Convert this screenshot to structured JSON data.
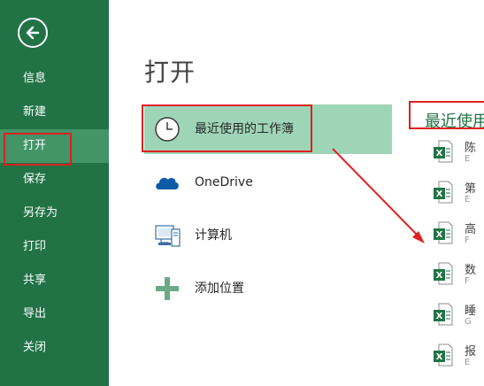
{
  "sidebar": {
    "items": [
      {
        "label": "信息"
      },
      {
        "label": "新建"
      },
      {
        "label": "打开"
      },
      {
        "label": "保存"
      },
      {
        "label": "另存为"
      },
      {
        "label": "打印"
      },
      {
        "label": "共享"
      },
      {
        "label": "导出"
      },
      {
        "label": "关闭"
      }
    ],
    "selected": "打开"
  },
  "main": {
    "title": "打开",
    "places": [
      {
        "label": "最近使用的工作簿",
        "icon": "clock-icon"
      },
      {
        "label": "OneDrive",
        "icon": "cloud-icon"
      },
      {
        "label": "计算机",
        "icon": "computer-icon"
      },
      {
        "label": "添加位置",
        "icon": "plus-icon"
      }
    ],
    "recent_title": "最近使用",
    "recent_files": [
      {
        "name": "陈",
        "path": "E"
      },
      {
        "name": "第",
        "path": "E"
      },
      {
        "name": "高",
        "path": "F"
      },
      {
        "name": "数",
        "path": "F"
      },
      {
        "name": "睡",
        "path": "G"
      },
      {
        "name": "报",
        "path": "E"
      }
    ]
  },
  "colors": {
    "sidebar": "#217346",
    "selected_nav": "#439467",
    "selected_place": "#9fd5b7",
    "annotation": "#e02020"
  }
}
